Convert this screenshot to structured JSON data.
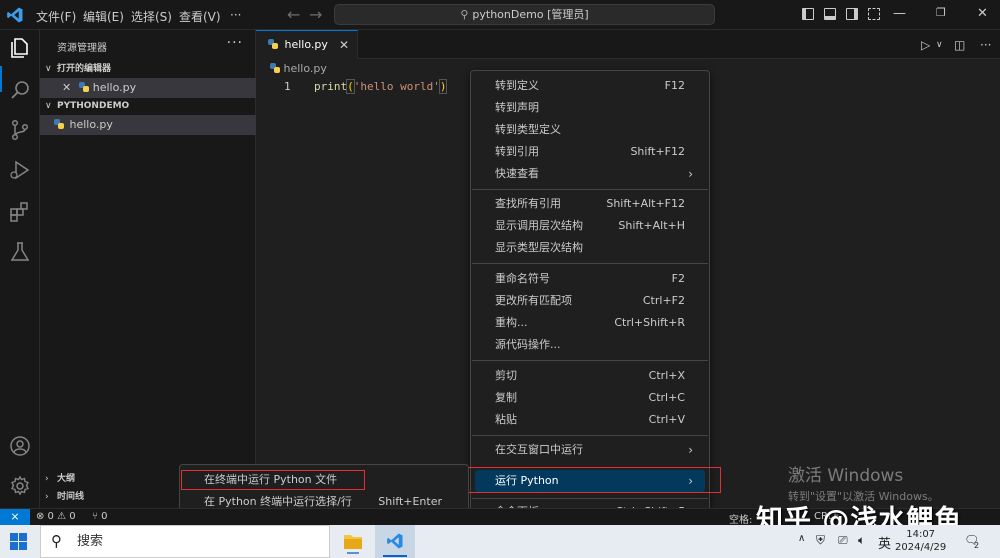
{
  "titlebar": {
    "menus": [
      "文件(F)",
      "编辑(E)",
      "选择(S)",
      "查看(V)",
      "···"
    ],
    "search_text": "pythonDemo [管理员]",
    "colors": {
      "accent": "#0078d4"
    }
  },
  "activitybar": {
    "icons": [
      "explorer-icon",
      "search-icon",
      "source-control-icon",
      "run-debug-icon",
      "extensions-icon",
      "testing-icon",
      "account-icon",
      "settings-icon"
    ]
  },
  "sidebar": {
    "title": "资源管理器",
    "more": "···",
    "open_editors_header": "打开的编辑器",
    "open_editors": [
      {
        "name": "hello.py",
        "close": "✕"
      }
    ],
    "project_header": "PYTHONDEMO",
    "files": [
      {
        "name": "hello.py"
      }
    ],
    "outline_header": "大纲",
    "timeline_header": "时间线"
  },
  "editor": {
    "tab": {
      "label": "hello.py",
      "close": "✕"
    },
    "breadcrumb": "hello.py",
    "line_number": "1",
    "code": {
      "fn": "print",
      "open": "(",
      "str": "'hello world'",
      "close": ")"
    }
  },
  "context_menu": {
    "groups": [
      [
        {
          "label": "转到定义",
          "shortcut": "F12"
        },
        {
          "label": "转到声明",
          "shortcut": ""
        },
        {
          "label": "转到类型定义",
          "shortcut": ""
        },
        {
          "label": "转到引用",
          "shortcut": "Shift+F12"
        },
        {
          "label": "快速查看",
          "shortcut": "",
          "arrow": "›"
        }
      ],
      [
        {
          "label": "查找所有引用",
          "shortcut": "Shift+Alt+F12"
        },
        {
          "label": "显示调用层次结构",
          "shortcut": "Shift+Alt+H"
        },
        {
          "label": "显示类型层次结构",
          "shortcut": ""
        }
      ],
      [
        {
          "label": "重命名符号",
          "shortcut": "F2"
        },
        {
          "label": "更改所有匹配项",
          "shortcut": "Ctrl+F2"
        },
        {
          "label": "重构...",
          "shortcut": "Ctrl+Shift+R"
        },
        {
          "label": "源代码操作...",
          "shortcut": ""
        }
      ],
      [
        {
          "label": "剪切",
          "shortcut": "Ctrl+X"
        },
        {
          "label": "复制",
          "shortcut": "Ctrl+C"
        },
        {
          "label": "粘贴",
          "shortcut": "Ctrl+V"
        }
      ],
      [
        {
          "label": "在交互窗口中运行",
          "shortcut": "",
          "arrow": "›"
        },
        {
          "label": "运行 Python",
          "shortcut": "",
          "arrow": "›",
          "highlighted": true
        }
      ],
      [
        {
          "label": "命令面板...",
          "shortcut": "Ctrl+Shift+P"
        }
      ]
    ]
  },
  "submenu": {
    "items": [
      {
        "label": "在终端中运行 Python 文件",
        "shortcut": ""
      },
      {
        "label": "在 Python 终端中运行选择/行",
        "shortcut": "Shift+Enter"
      }
    ]
  },
  "statusbar": {
    "remote": "⨯",
    "problems": "⊗ 0 ⚠ 0",
    "ports": "⑂ 0",
    "spaces": "空格:",
    "crlf": "CRLF"
  },
  "watermark": {
    "line1": "激活 Windows",
    "line2": "转到\"设置\"以激活 Windows。",
    "brand": "知乎 @浅水鲤鱼"
  },
  "taskbar": {
    "search_placeholder": "搜索",
    "ime": "英",
    "time": "14:07",
    "date": "2024/4/29",
    "notification_count": "2"
  }
}
